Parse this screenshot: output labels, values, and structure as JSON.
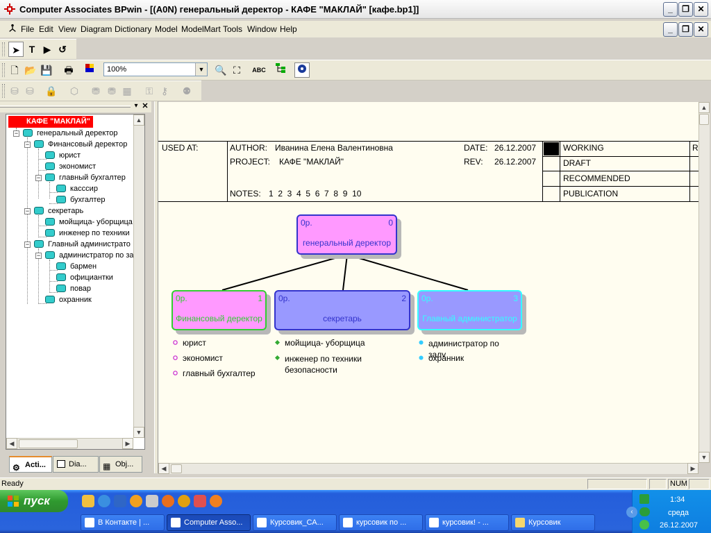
{
  "window": {
    "title": "Computer Associates BPwin - [(A0N) генеральный деректор - КАФЕ \"МАКЛАЙ\"  [кафе.bp1]]"
  },
  "menu": [
    "File",
    "Edit",
    "View",
    "Diagram",
    "Dictionary",
    "Model",
    "ModelMart",
    "Tools",
    "Window",
    "Help"
  ],
  "toolbar": {
    "zoom": "100%"
  },
  "tree": {
    "root": "КАФЕ \"МАКЛАЙ\"",
    "nodes": [
      {
        "label": "генеральный деректор",
        "level": 1
      },
      {
        "label": "Финансовый деректор",
        "level": 2
      },
      {
        "label": "юрист",
        "level": 3
      },
      {
        "label": "экономист",
        "level": 3
      },
      {
        "label": "главный бухгалтер",
        "level": 3
      },
      {
        "label": "касссир",
        "level": 4
      },
      {
        "label": "бухгалтер",
        "level": 4
      },
      {
        "label": "секретарь",
        "level": 2
      },
      {
        "label": "мойщица- уборщица",
        "level": 3
      },
      {
        "label": "инженер по техники",
        "level": 3
      },
      {
        "label": "Главный администрато",
        "level": 2
      },
      {
        "label": "администратор по за",
        "level": 3
      },
      {
        "label": "бармен",
        "level": 4
      },
      {
        "label": "официантки",
        "level": 4
      },
      {
        "label": "повар",
        "level": 4
      },
      {
        "label": "охранник",
        "level": 3
      }
    ]
  },
  "tabs": [
    "Acti...",
    "Dia...",
    "Obj..."
  ],
  "frame": {
    "used_at": "USED AT:",
    "author_label": "AUTHOR:",
    "author": "Иванина Елена Валентиновна",
    "project_label": "PROJECT:",
    "project": "КАФЕ \"МАКЛАЙ\"",
    "date_label": "DATE:",
    "date": "26.12.2007",
    "rev_label": "REV:",
    "rev": "26.12.2007",
    "notes_label": "NOTES:",
    "notes": "1  2  3  4  5  6  7  8  9  10",
    "statuses": [
      "WORKING",
      "DRAFT",
      "RECOMMENDED",
      "PUBLICATION"
    ],
    "reader_partial": "R"
  },
  "boxes": [
    {
      "cost": "0р.",
      "num": "0",
      "name": "генеральный деректор",
      "fill": "#ff99ff",
      "border": "#3333cc"
    },
    {
      "cost": "0р.",
      "num": "1",
      "name": "Финансовый деректор",
      "fill": "#ff99ff",
      "border": "#33cc33"
    },
    {
      "cost": "0р.",
      "num": "2",
      "name": "секретарь",
      "fill": "#9999ff",
      "border": "#3333cc"
    },
    {
      "cost": "0р.",
      "num": "3",
      "name": "Главный администратор",
      "fill": "#9999ff",
      "border": "#33ffff"
    }
  ],
  "sublists": {
    "finance": [
      "юрист",
      "экономист",
      "главный бухгалтер"
    ],
    "secretary": [
      "мойщица- уборщица",
      "инженер по техники безопасности"
    ],
    "admin": [
      "администратор по залу",
      "охранник"
    ]
  },
  "status": {
    "text": "Ready",
    "num": "NUM"
  },
  "taskbar": {
    "start": "пуск",
    "tasks": [
      "В Контакте | ...",
      "Computer Asso...",
      "Курсовик_СА...",
      "курсовик по ...",
      "курсовик! - ...",
      "Курсовик"
    ],
    "time": "1:34",
    "day": "среда",
    "date": "26.12.2007"
  }
}
